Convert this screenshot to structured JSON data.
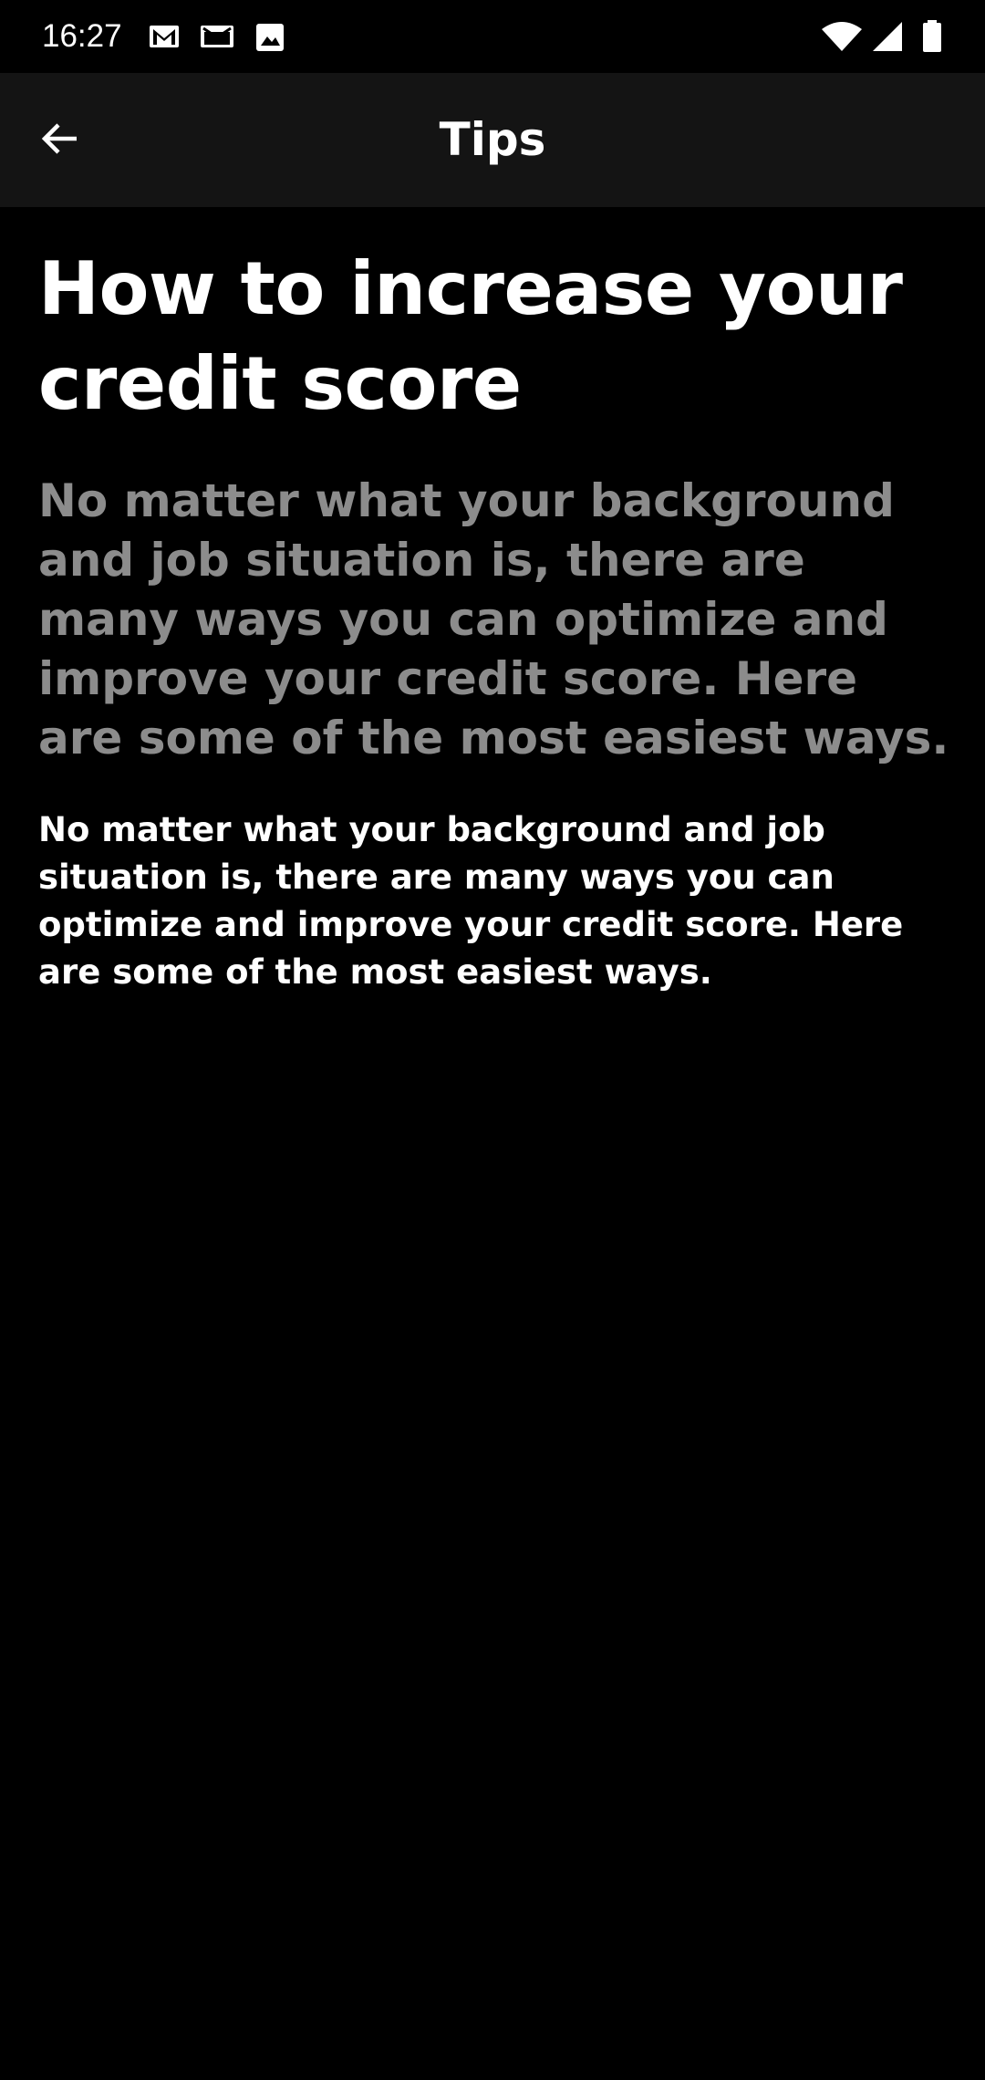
{
  "status_bar": {
    "time": "16:27",
    "notification_icons": [
      "gmail-icon",
      "email-icon",
      "image-icon"
    ],
    "system_icons": [
      "wifi-icon",
      "cellular-signal-icon",
      "battery-icon"
    ]
  },
  "app_bar": {
    "back_icon": "arrow-left-icon",
    "title": "Tips"
  },
  "article": {
    "heading": "How to increase your credit score",
    "lead": "No matter what your background and job situation is, there are many ways you can optimize and improve your credit score. Here are some of the most easiest ways.",
    "body": "No matter what your background and job situation is, there are many ways you can optimize and improve your credit score. Here are some of the most easiest ways."
  },
  "colors": {
    "background": "#000000",
    "app_bar": "#141414",
    "text_primary": "#ffffff",
    "text_secondary": "#8c8c8c"
  }
}
